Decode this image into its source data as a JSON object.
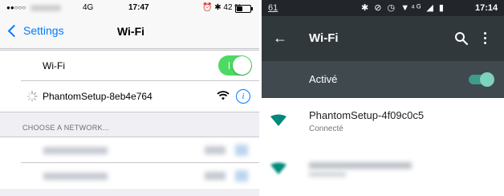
{
  "ios": {
    "status": {
      "dots": "●●○○○",
      "network": "4G",
      "time": "17:47",
      "battery_text": "42 %",
      "battery_level": 0.42
    },
    "nav": {
      "back_label": "Settings",
      "title": "Wi-Fi"
    },
    "wifi_row": {
      "label": "Wi-Fi",
      "enabled": true
    },
    "connected_network": {
      "name": "PhantomSetup-8eb4e764",
      "info_glyph": "i"
    },
    "section_header": "CHOOSE A NETWORK...",
    "blurred_networks": 2,
    "colors": {
      "accent": "#007aff",
      "toggle_on": "#4cd964"
    }
  },
  "android": {
    "status": {
      "notification_count": "61",
      "time": "17:14",
      "icons": "✱ ⊘ ◷ ▼⁴ᴳ ◢ ▮"
    },
    "toolbar": {
      "back_glyph": "←",
      "title": "Wi-Fi"
    },
    "switch_bar": {
      "label": "Activé",
      "enabled": true
    },
    "networks": [
      {
        "name": "PhantomSetup-4f09c0c5",
        "status": "Connecté",
        "blurred": false
      },
      {
        "name": "",
        "status": "",
        "blurred": true
      }
    ],
    "colors": {
      "toolbar": "#31383c",
      "switch_bar": "#40494e",
      "accent": "#009688"
    }
  }
}
